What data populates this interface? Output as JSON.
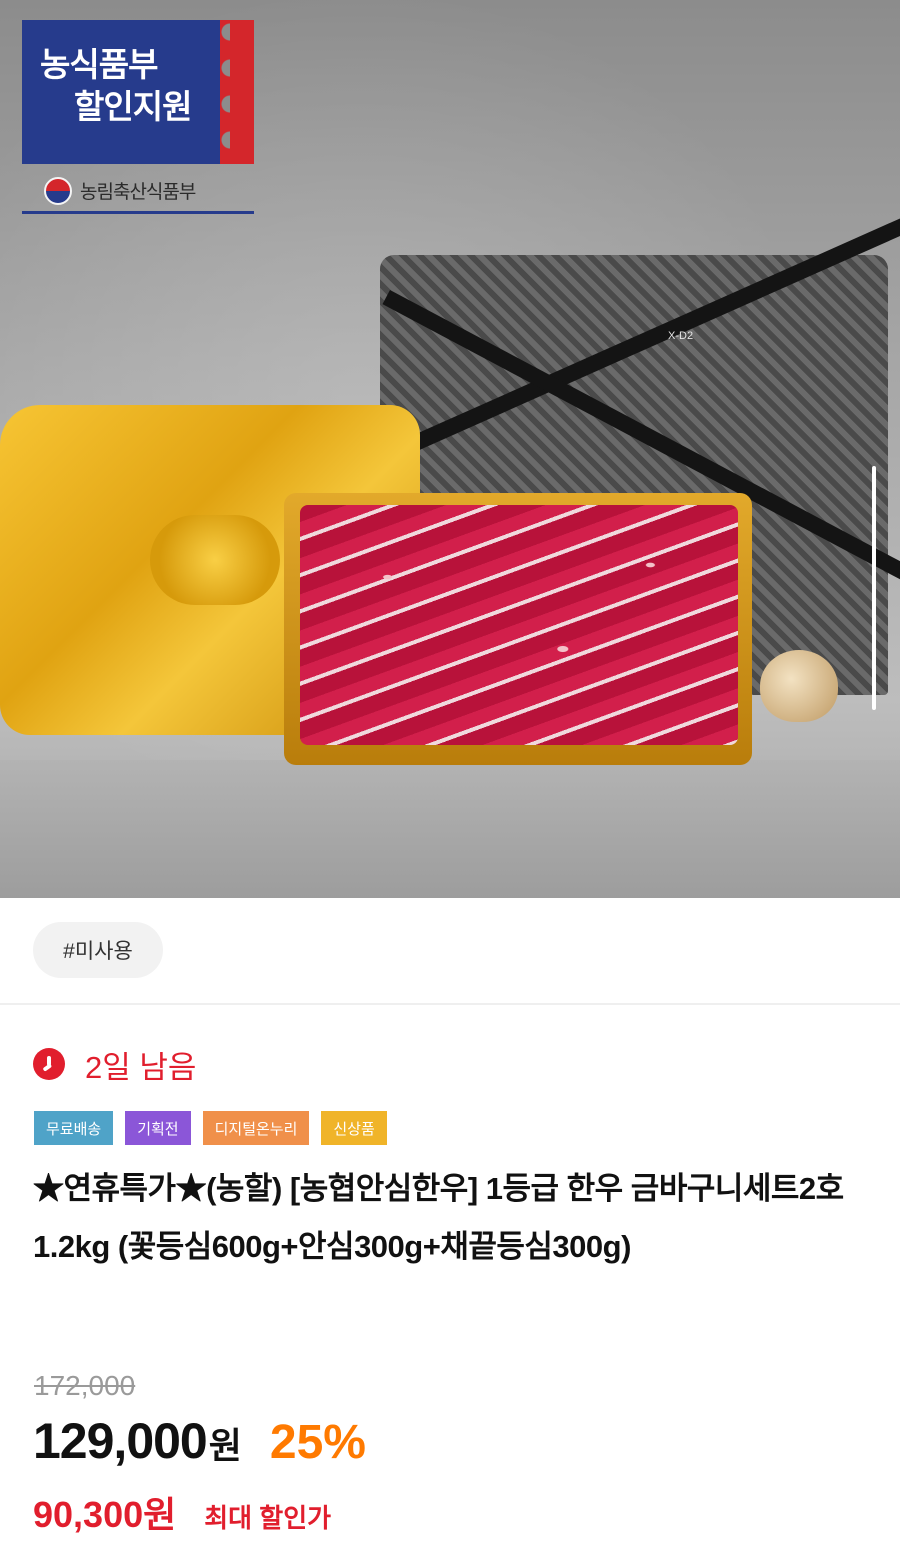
{
  "hero": {
    "badge_line1": "농식품부",
    "badge_line2": "할인지원",
    "ministry": "농림축산식품부",
    "bag_label": "X-D2"
  },
  "tag_chip": "#미사용",
  "countdown": "2일 남음",
  "badges": [
    {
      "label": "무료배송",
      "color": "#4fa3c8"
    },
    {
      "label": "기획전",
      "color": "#8b56d8"
    },
    {
      "label": "디지털온누리",
      "color": "#f0904a"
    },
    {
      "label": "신상품",
      "color": "#f0b429"
    }
  ],
  "title": "★연휴특가★(농할) [농협안심한우] 1등급 한우 금바구니세트2호 1.2kg (꽃등심600g+안심300g+채끝등심300g)",
  "pricing": {
    "original": "172,000",
    "price": "129,000",
    "unit": "원",
    "discount": "25%",
    "max_price": "90,300원",
    "max_label": "최대 할인가"
  },
  "colors": {
    "accent_red": "#e11e2d",
    "discount_orange": "#ff7a00",
    "badge_navy": "#263b8c"
  }
}
